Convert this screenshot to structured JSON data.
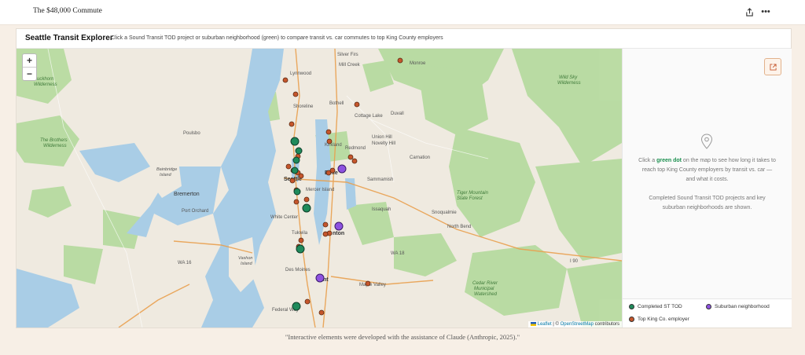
{
  "page": {
    "title": "The $48,000 Commute",
    "caption": "\"Interactive elements were developed with the assistance of Claude (Anthropic, 2025).\""
  },
  "toolbar": {
    "share_icon": "share-icon",
    "more_icon": "more-horizontal-icon",
    "more_label": "•••"
  },
  "panel": {
    "title": "Seattle Transit Explorer",
    "subtitle": "Click a Sound Transit TOD project or suburban neighborhood (green) to compare transit vs. car commutes to top King County employers"
  },
  "map": {
    "zoom_in": "+",
    "zoom_out": "−",
    "attribution_leaflet": "Leaflet",
    "attribution_sep": " | © ",
    "attribution_osm": "OpenStreetMap",
    "attribution_tail": " contributors",
    "labels": {
      "buckhorn": "Buckhorn",
      "wilderness1": "Wilderness",
      "brothers": "The Brothers",
      "wilderness2": "Wilderness",
      "lynnwood": "Lynnwood",
      "shoreline": "Shoreline",
      "bothell": "Bothell",
      "cottage_lake": "Cottage Lake",
      "kirkland": "Kirkland",
      "redmond": "Redmond",
      "union_hill": "Union Hill",
      "novelty_hill": "Novelty Hill",
      "duvall": "Duvall",
      "carnation": "Carnation",
      "seattle": "Seattle",
      "bellevue": "Belle",
      "mercer_island": "Mercer Island",
      "sammamish": "Sammamish",
      "issaquah": "Issaquah",
      "snoqualmie": "Snoqualmie",
      "north_bend": "North Bend",
      "bremerton": "Bremerton",
      "port_orchard": "Port Orchard",
      "white_center": "White Center",
      "renton": "nton",
      "tukwila": "Tukwila",
      "des_moines": "Des Moines",
      "kent": "nt",
      "maple_valley": "Maple Valley",
      "federal_way": "Federal Way",
      "vashon": "Vashon",
      "vashon_island": "Island",
      "bainbridge": "Bainbridge",
      "bainbridge_island": "Island",
      "poulsbo": "Poulsbo",
      "silver_firs": "Silver Firs",
      "mill_creek": "Mill Creek",
      "monroe": "Monroe",
      "wild_sky": "Wild Sky",
      "wilderness3": "Wilderness",
      "cedar_river": "Cedar River",
      "municipal": "Municipal",
      "watershed": "Watershed",
      "tiger_mtn": "Tiger Mountain",
      "state_forest": "State Forest",
      "wa16": "WA 16",
      "wa18": "WA 18",
      "i90": "I 90"
    }
  },
  "side": {
    "info_pre": "Click a ",
    "info_bold": "green dot",
    "info_post": " on the map to see how long it takes to reach top King County employers by transit vs. car — and what it costs.",
    "info2": "Completed Sound Transit TOD projects and key suburban neighborhoods are shown.",
    "pin_icon": "map-pin-icon",
    "expand_icon": "open-external-icon"
  },
  "legend": {
    "tod": {
      "label": "Completed ST TOD",
      "color": "#1f8a5b"
    },
    "suburban": {
      "label": "Suburban neighborhood",
      "color": "#8e52e0"
    },
    "employer": {
      "label": "Top King Co. employer",
      "color": "#c5562c"
    }
  },
  "colors": {
    "water": "#a9cde6",
    "park": "#b7dba0",
    "land": "#efeae0",
    "road": "#e9a04f"
  }
}
